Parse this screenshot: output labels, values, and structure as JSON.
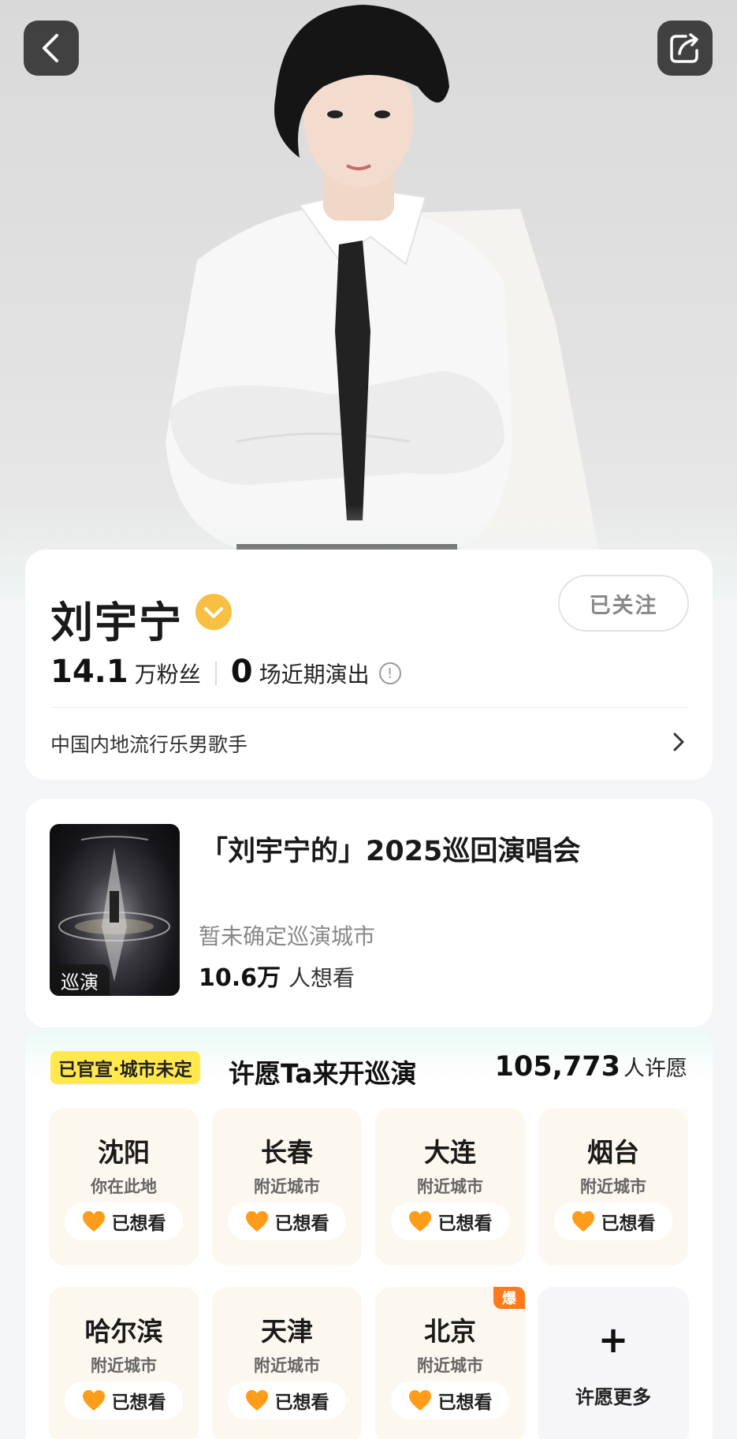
{
  "header": {
    "back_icon": "chevron-left-icon",
    "share_icon": "share-icon"
  },
  "artist": {
    "name": "刘宇宁",
    "verified_icon": "verified-badge-icon",
    "follow_label": "已关注",
    "fans_num": "14.1",
    "fans_label": "万粉丝",
    "shows_num": "0",
    "shows_label": "场近期演出",
    "genre": "中国内地流行乐男歌手"
  },
  "tour": {
    "poster_tag": "巡演",
    "title": "「刘宇宁的」2025巡回演唱会",
    "city_status": "暂未确定巡演城市",
    "wants_num": "10.6万",
    "wants_label": "人想看"
  },
  "wish": {
    "tag": "已官宣·城市未定",
    "title": "许愿Ta来开巡演",
    "count_num": "105,773",
    "count_label": "人许愿",
    "cities": [
      {
        "name": "沈阳",
        "sub": "你在此地",
        "want": "已想看",
        "hot": ""
      },
      {
        "name": "长春",
        "sub": "附近城市",
        "want": "已想看",
        "hot": ""
      },
      {
        "name": "大连",
        "sub": "附近城市",
        "want": "已想看",
        "hot": ""
      },
      {
        "name": "烟台",
        "sub": "附近城市",
        "want": "已想看",
        "hot": ""
      },
      {
        "name": "哈尔滨",
        "sub": "附近城市",
        "want": "已想看",
        "hot": ""
      },
      {
        "name": "天津",
        "sub": "附近城市",
        "want": "已想看",
        "hot": ""
      },
      {
        "name": "北京",
        "sub": "附近城市",
        "want": "已想看",
        "hot": "爆"
      }
    ],
    "more_label": "许愿更多",
    "heart_color": "#ff9d1a"
  },
  "colors": {
    "verify": "#f7c043",
    "tag_yellow": "#ffe94d",
    "hot_orange": "#ff7a1a"
  }
}
